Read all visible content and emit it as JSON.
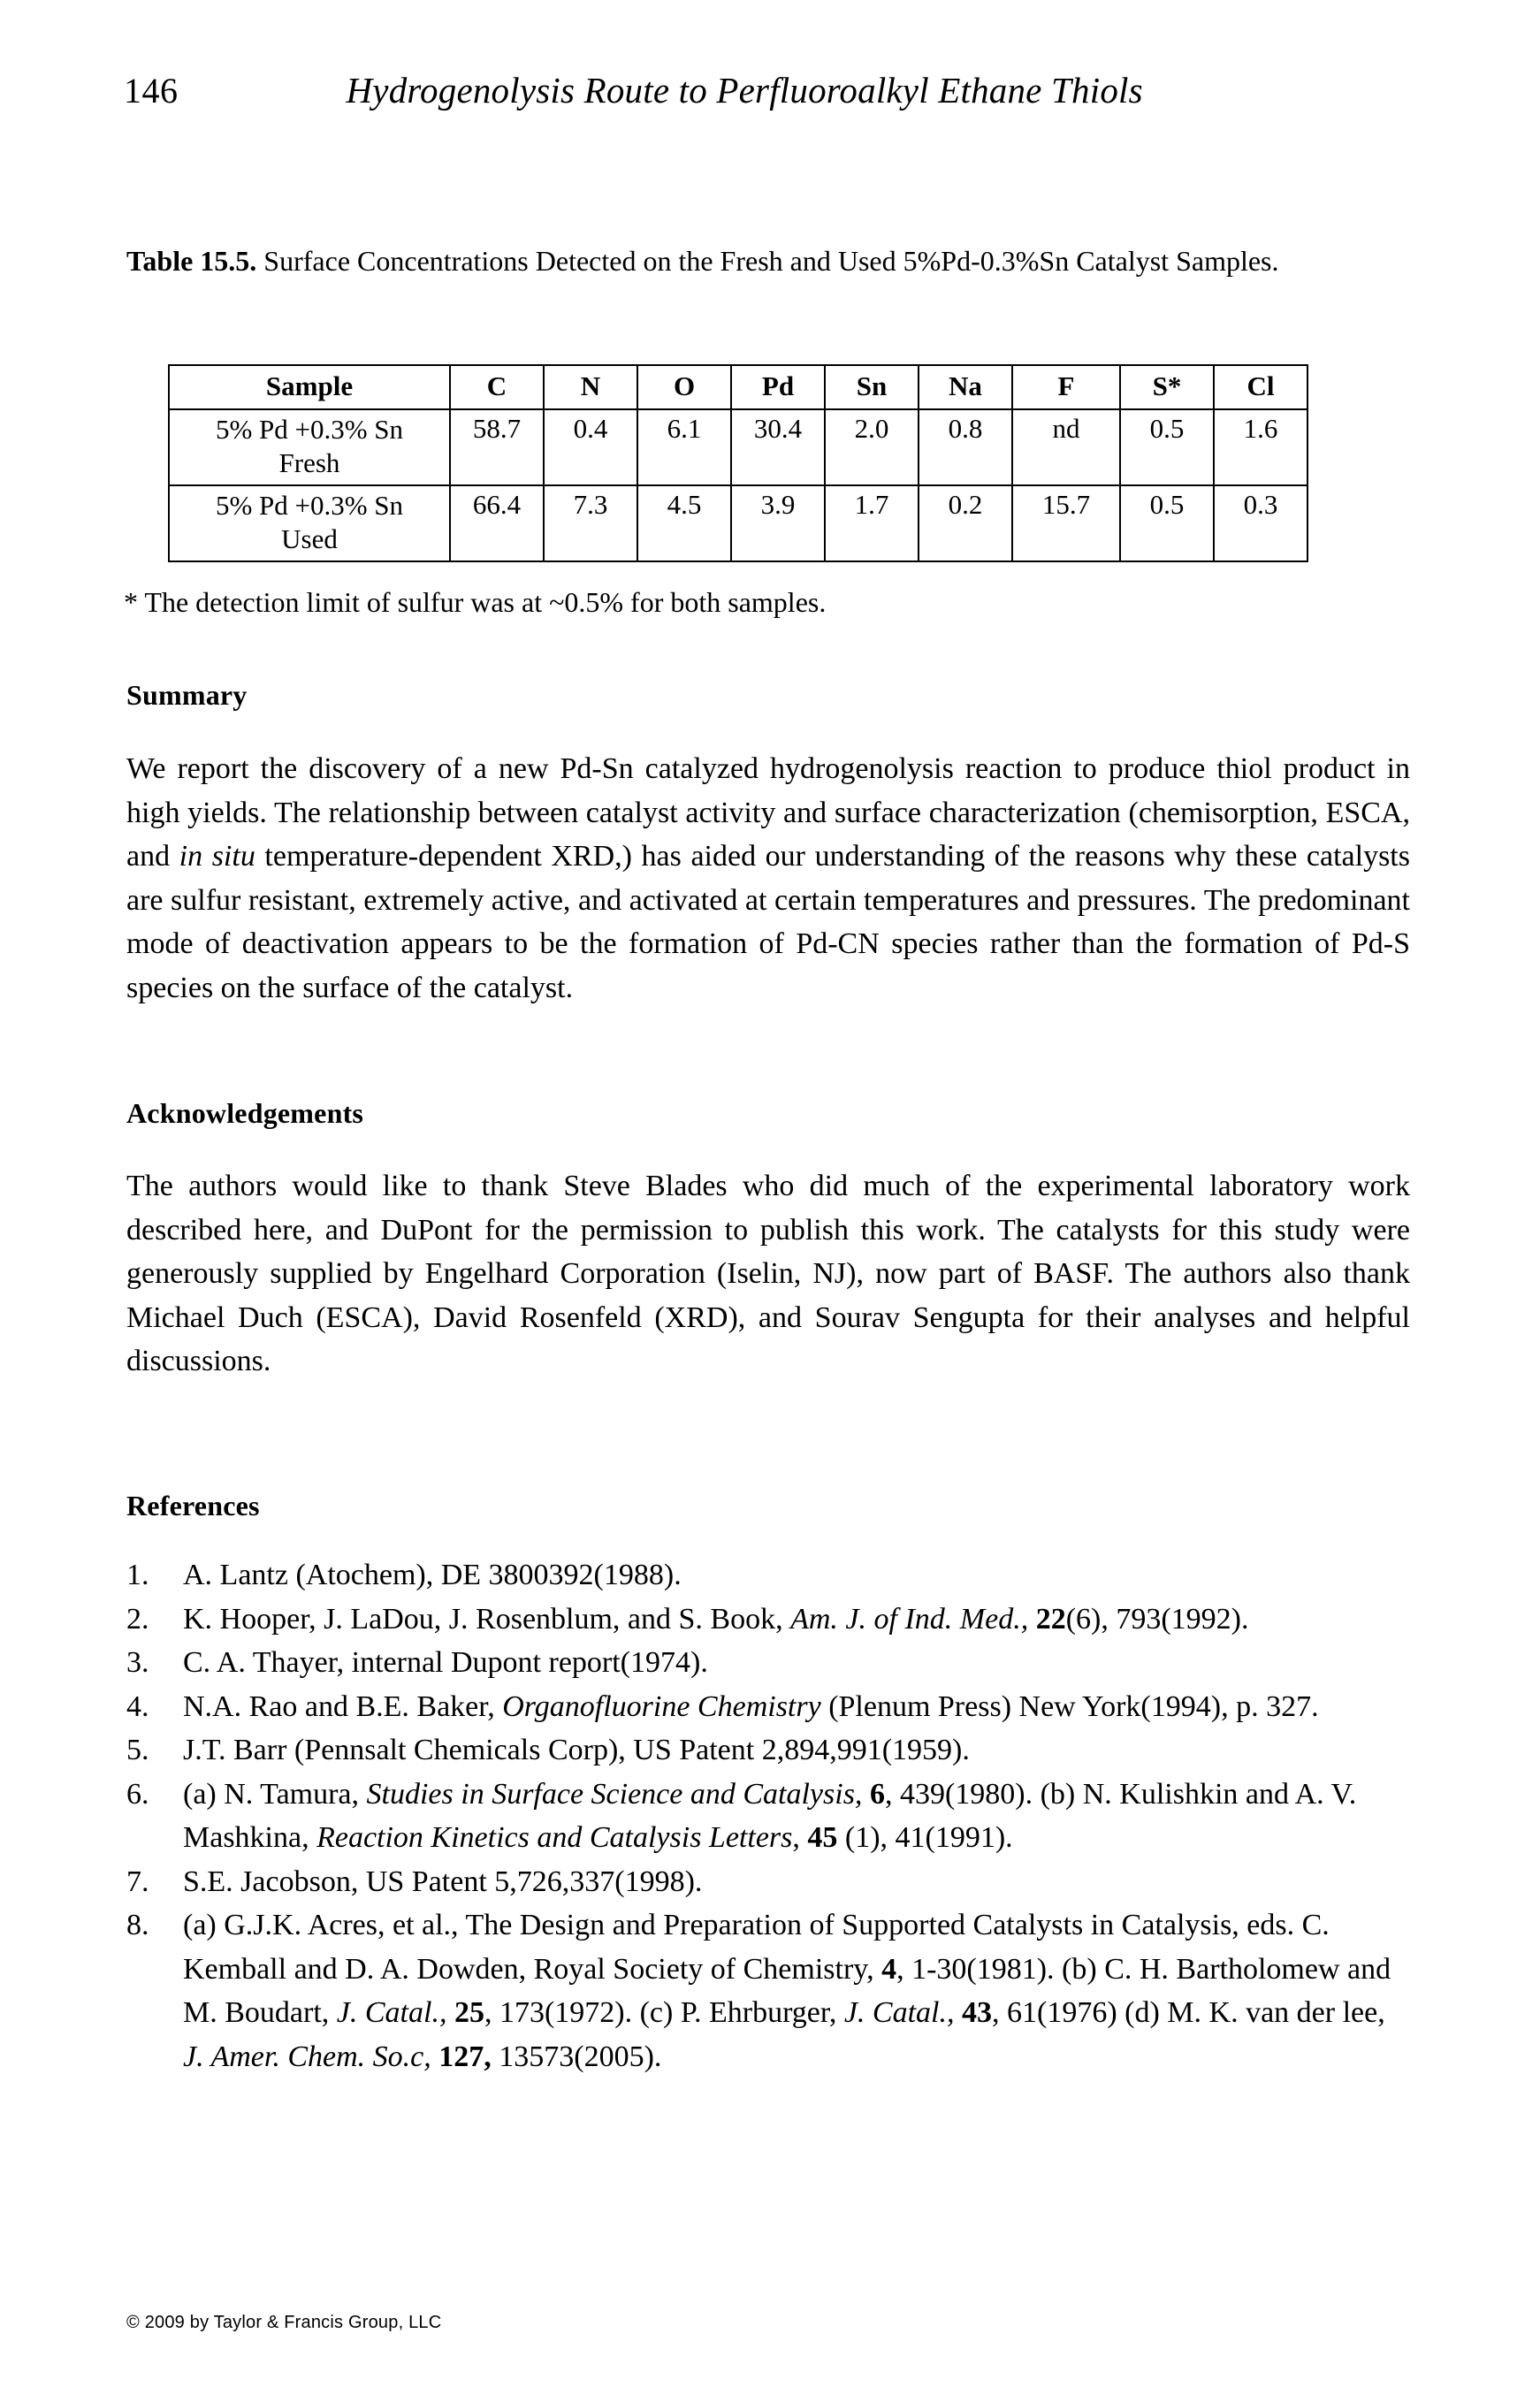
{
  "running_head": {
    "page_number": "146",
    "title": "Hydrogenolysis Route to Perfluoroalkyl Ethane Thiols"
  },
  "table_block": {
    "caption_label": "Table 15.5.",
    "caption_text": " Surface Concentrations Detected on the Fresh and Used 5%Pd-0.3%Sn Catalyst Samples.",
    "footnote": "* The detection limit of sulfur was at ~0.5% for both samples.",
    "columns": [
      "Sample",
      "C",
      "N",
      "O",
      "Pd",
      "Sn",
      "Na",
      "F",
      "S*",
      "Cl"
    ],
    "rows": [
      {
        "sample_line1": "5% Pd +0.3% Sn",
        "sample_line2": "Fresh",
        "values": [
          "58.7",
          "0.4",
          "6.1",
          "30.4",
          "2.0",
          "0.8",
          "nd",
          "0.5",
          "1.6"
        ]
      },
      {
        "sample_line1": "5% Pd +0.3% Sn",
        "sample_line2": "Used",
        "values": [
          "66.4",
          "7.3",
          "4.5",
          "3.9",
          "1.7",
          "0.2",
          "15.7",
          "0.5",
          "0.3"
        ]
      }
    ]
  },
  "summary": {
    "heading": "Summary",
    "text_part1": "We report the discovery of a new Pd-Sn catalyzed hydrogenolysis reaction to produce thiol product in high yields.  The relationship between catalyst activity and surface characterization (chemisorption, ESCA, and ",
    "text_italic": "in situ",
    "text_part2": " temperature-dependent XRD,) has aided our understanding of the reasons why these catalysts are sulfur resistant, extremely active, and activated at certain temperatures and pressures.  The predominant mode of deactivation appears to be the formation of Pd-CN species rather than the formation of Pd-S species on the surface of the catalyst."
  },
  "acknowledgements": {
    "heading": "Acknowledgements",
    "text": "The authors would like to thank Steve Blades who did much of the experimental laboratory work described here, and DuPont for the permission to publish this work.  The catalysts for this study were generously supplied by Engelhard Corporation (Iselin, NJ), now part of BASF.  The authors also thank Michael Duch (ESCA), David Rosenfeld (XRD), and Sourav Sengupta for their analyses and helpful discussions."
  },
  "references": {
    "heading": "References",
    "items": [
      {
        "number": "1.",
        "segments": [
          {
            "text": "A. Lantz (Atochem),  DE 3800392(1988).",
            "style": "normal"
          }
        ]
      },
      {
        "number": "2.",
        "segments": [
          {
            "text": "K. Hooper, J. LaDou, J. Rosenblum, and S. Book, ",
            "style": "normal"
          },
          {
            "text": "Am. J.  of Ind. Med.,",
            "style": "italic"
          },
          {
            "text": " ",
            "style": "normal"
          },
          {
            "text": "22",
            "style": "bold"
          },
          {
            "text": "(6), 793(1992).",
            "style": "normal"
          }
        ]
      },
      {
        "number": "3.",
        "segments": [
          {
            "text": "C. A. Thayer, internal Dupont report(1974).",
            "style": "normal"
          }
        ]
      },
      {
        "number": "4.",
        "segments": [
          {
            "text": "N.A. Rao and B.E. Baker, ",
            "style": "normal"
          },
          {
            "text": "Organofluorine Chemistry",
            "style": "italic"
          },
          {
            "text": " (Plenum Press) New York(1994), p. 327.",
            "style": "normal"
          }
        ]
      },
      {
        "number": "5.",
        "segments": [
          {
            "text": "J.T. Barr (Pennsalt Chemicals Corp), US Patent 2,894,991(1959).",
            "style": "normal"
          }
        ]
      },
      {
        "number": "6.",
        "segments": [
          {
            "text": " (a) N. Tamura, ",
            "style": "normal"
          },
          {
            "text": "Studies in Surface Science and Catalysis,",
            "style": "italic"
          },
          {
            "text": " ",
            "style": "normal"
          },
          {
            "text": "6",
            "style": "bold"
          },
          {
            "text": ", 439(1980). (b) N. Kulishkin and A. V. Mashkina, ",
            "style": "normal"
          },
          {
            "text": "Reaction Kinetics and Catalysis Letters",
            "style": "italic"
          },
          {
            "text": ", ",
            "style": "normal"
          },
          {
            "text": "45",
            "style": "bold"
          },
          {
            "text": " (1), 41(1991).",
            "style": "normal"
          }
        ]
      },
      {
        "number": "7.",
        "segments": [
          {
            "text": " S.E. Jacobson, US Patent 5,726,337(1998).",
            "style": "normal"
          }
        ]
      },
      {
        "number": "8.",
        "segments": [
          {
            "text": "(a) G.J.K. Acres, et al., The Design and Preparation of Supported Catalysts in Catalysis, eds. C. Kemball and D. A. Dowden, Royal Society of Chemistry, ",
            "style": "normal"
          },
          {
            "text": "4",
            "style": "bold"
          },
          {
            "text": ", 1-30(1981). (b) C. H. Bartholomew and M. Boudart, ",
            "style": "normal"
          },
          {
            "text": "J. Catal.,",
            "style": "italic"
          },
          {
            "text": " ",
            "style": "normal"
          },
          {
            "text": "25",
            "style": "bold"
          },
          {
            "text": ", 173(1972). (c) P. Ehrburger, ",
            "style": "normal"
          },
          {
            "text": "J. Catal.,",
            "style": "italic"
          },
          {
            "text": " ",
            "style": "normal"
          },
          {
            "text": "43",
            "style": "bold"
          },
          {
            "text": ", 61(1976) (d) M. K. van der lee, ",
            "style": "normal"
          },
          {
            "text": "J. Amer. Chem. So.c,",
            "style": "italic"
          },
          {
            "text": " ",
            "style": "normal"
          },
          {
            "text": "127,",
            "style": "bold"
          },
          {
            "text": " 13573(2005).",
            "style": "normal"
          }
        ]
      }
    ]
  },
  "footer": {
    "copyright": "© 2009 by Taylor & Francis Group, LLC"
  }
}
